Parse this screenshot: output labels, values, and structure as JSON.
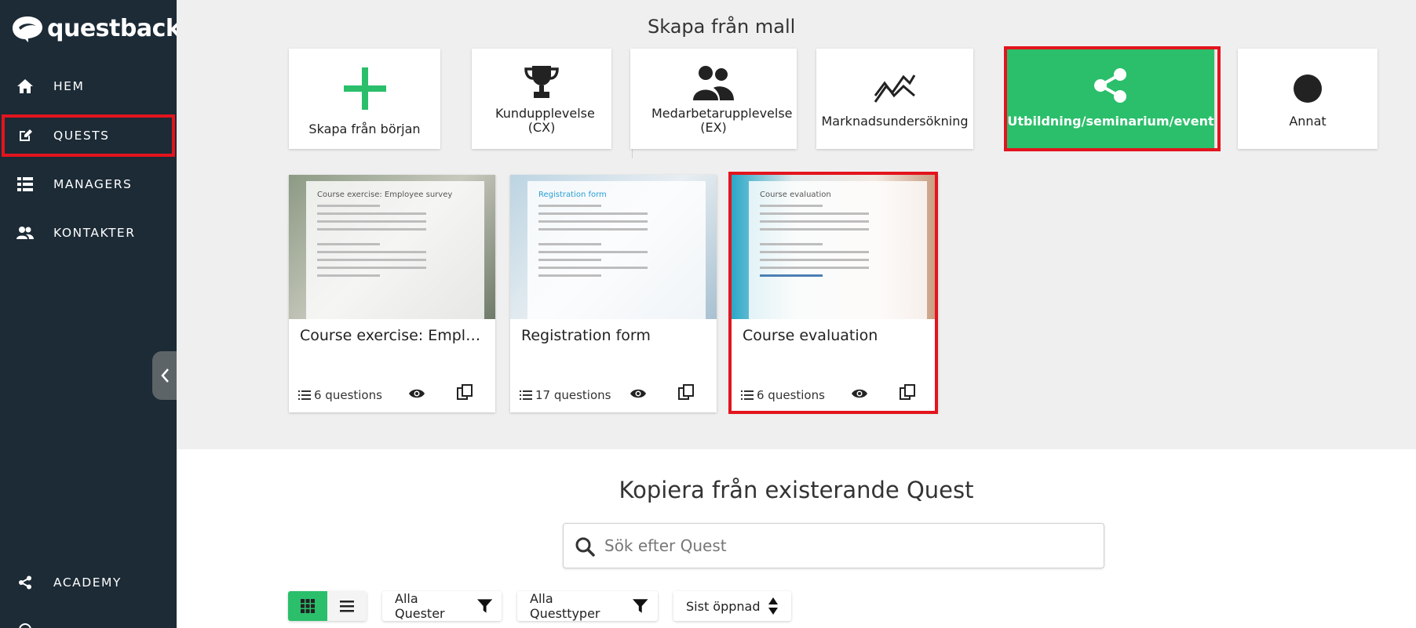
{
  "app": {
    "logo_text": "questback"
  },
  "sidebar": {
    "items": [
      {
        "label": "HEM"
      },
      {
        "label": "QUESTS"
      },
      {
        "label": "MANAGERS"
      },
      {
        "label": "KONTAKTER"
      },
      {
        "label": "ACADEMY"
      }
    ]
  },
  "templates": {
    "section_title": "Skapa från mall",
    "create_blank": "Skapa från början",
    "tiles": [
      {
        "label": "Kundupplevelse (CX)",
        "icon": "trophy-icon"
      },
      {
        "label": "Medarbetarupplevelse (EX)",
        "icon": "people-icon"
      },
      {
        "label": "Marknadsundersökning",
        "icon": "trend-lines-icon"
      },
      {
        "label": "Utbildning/seminarium/event",
        "icon": "share-icon",
        "selected": true
      },
      {
        "label": "Annat",
        "icon": "dot-icon"
      }
    ],
    "cards": [
      {
        "title": "Course exercise: Employee survey",
        "questions": "6 questions",
        "thumb_title": "Course exercise: Employee survey"
      },
      {
        "title": "Registration form",
        "questions": "17 questions",
        "thumb_title": "Registration form"
      },
      {
        "title": "Course evaluation",
        "questions": "6 questions",
        "thumb_title": "Course evaluation"
      }
    ]
  },
  "copy_section": {
    "title": "Kopiera från existerande Quest",
    "search_placeholder": "Sök efter Quest"
  },
  "filters": {
    "all_quests": "Alla Quester",
    "all_types": "Alla Questtyper",
    "sort": "Sist öppnad"
  },
  "colors": {
    "sidebar": "#1c2b36",
    "accent_green": "#2bbf6b",
    "highlight_red": "#e3141d",
    "background": "#efefef"
  }
}
